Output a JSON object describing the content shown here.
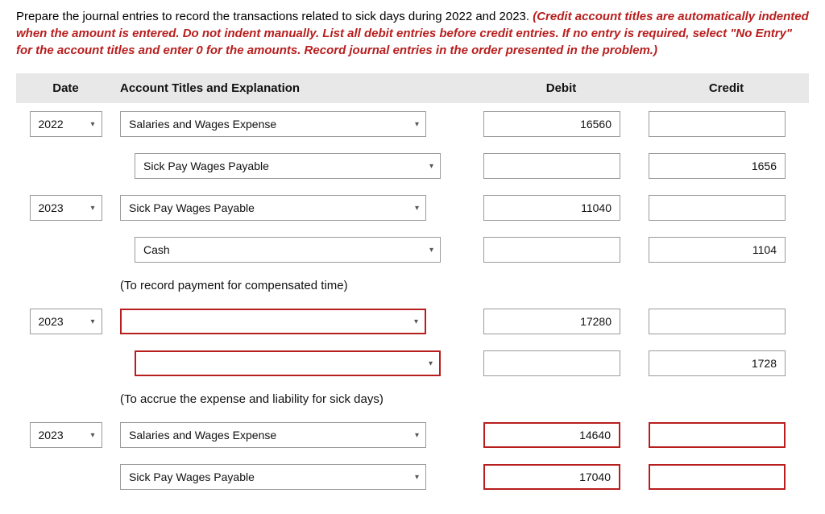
{
  "instructions": {
    "black": "Prepare the journal entries to record the transactions related to sick days during 2022 and 2023. ",
    "red": "(Credit account titles are automatically indented when the amount is entered. Do not indent manually. List all debit entries before credit entries. If no entry is required, select \"No Entry\" for the account titles and enter 0 for the amounts. Record journal entries in the order presented in the problem.)"
  },
  "headers": {
    "date": "Date",
    "account": "Account Titles and Explanation",
    "debit": "Debit",
    "credit": "Credit"
  },
  "rows": [
    {
      "date": "2022",
      "account": "Salaries and Wages Expense",
      "indent": false,
      "debit": "16560",
      "credit": "",
      "acct_err": false,
      "debit_err": false,
      "credit_err": false
    },
    {
      "date": "",
      "account": "Sick Pay Wages Payable",
      "indent": true,
      "debit": "",
      "credit": "1656",
      "acct_err": false,
      "debit_err": false,
      "credit_err": false
    },
    {
      "date": "2023",
      "account": "Sick Pay Wages Payable",
      "indent": false,
      "debit": "11040",
      "credit": "",
      "acct_err": false,
      "debit_err": false,
      "credit_err": false
    },
    {
      "date": "",
      "account": "Cash",
      "indent": true,
      "debit": "",
      "credit": "1104",
      "acct_err": false,
      "debit_err": false,
      "credit_err": false
    },
    {
      "explain": "(To record payment for compensated time)"
    },
    {
      "date": "2023",
      "account": "",
      "indent": false,
      "debit": "17280",
      "credit": "",
      "acct_err": true,
      "debit_err": false,
      "credit_err": false
    },
    {
      "date": "",
      "account": "",
      "indent": true,
      "debit": "",
      "credit": "1728",
      "acct_err": true,
      "debit_err": false,
      "credit_err": false
    },
    {
      "explain": "(To accrue the expense and liability for sick days)"
    },
    {
      "date": "2023",
      "account": "Salaries and Wages Expense",
      "indent": false,
      "debit": "14640",
      "credit": "",
      "acct_err": false,
      "debit_err": true,
      "credit_err": true
    },
    {
      "date": "",
      "account": "Sick Pay Wages Payable",
      "indent": false,
      "debit": "17040",
      "credit": "",
      "acct_err": false,
      "debit_err": true,
      "credit_err": true
    }
  ]
}
